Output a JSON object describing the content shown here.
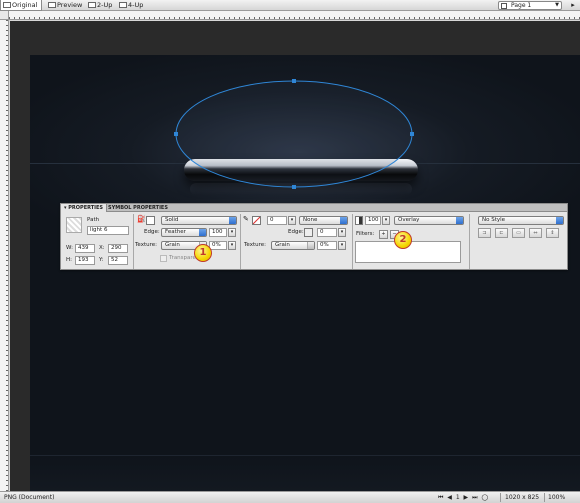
{
  "view_tabs": [
    {
      "label": "Original",
      "active": true
    },
    {
      "label": "Preview",
      "active": false
    },
    {
      "label": "2-Up",
      "active": false
    },
    {
      "label": "4-Up",
      "active": false
    }
  ],
  "page_select": {
    "value": "Page 1"
  },
  "callouts": [
    "1",
    "2"
  ],
  "properties_panel": {
    "tabs": [
      "PROPERTIES",
      "SYMBOL PROPERTIES"
    ],
    "object": {
      "type": "Path",
      "name": "light 6",
      "w": "439",
      "h": "193",
      "x": "290",
      "y": "52"
    },
    "fill": {
      "type": "Solid",
      "edge_label": "Edge:",
      "edge": "Feather",
      "edge_amount": "100",
      "texture_label": "Texture:",
      "texture": "Grain",
      "texture_amount": "0%",
      "transparent_label": "Transparent"
    },
    "stroke": {
      "size": "0",
      "type": "None",
      "edge_label": "Edge:",
      "edge_amount": "0",
      "texture_label": "Texture:",
      "texture": "Grain",
      "texture_amount": "0%"
    },
    "blend": {
      "opacity": "100",
      "mode": "Overlay",
      "filters_label": "Filters:"
    },
    "style": {
      "value": "No Style"
    },
    "labels": {
      "w": "W:",
      "h": "H:",
      "x": "X:",
      "y": "Y:"
    }
  },
  "status_bar": {
    "document": "PNG (Document)",
    "nav_glyphs": "⏮ ◀ 1 ▶ ⏭ ◯",
    "dimensions": "1020 x 825",
    "zoom": "100%"
  },
  "colors": {
    "path_stroke": "#2f86d6",
    "accent_blue": "#2f6fcf",
    "callout_fill": "#f5d600",
    "callout_border": "#c0392b"
  }
}
